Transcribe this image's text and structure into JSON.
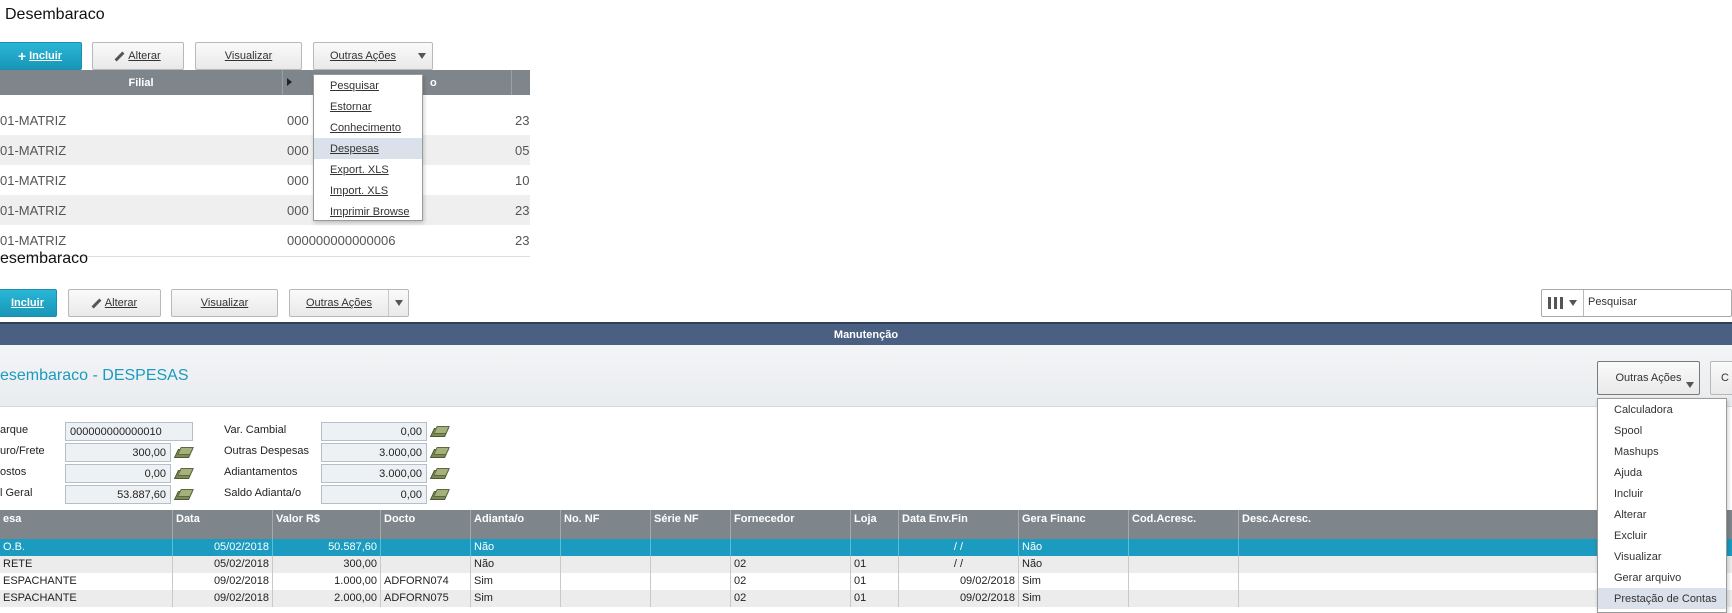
{
  "top": {
    "title": "Desembaraco",
    "toolbar": {
      "incluir_label": "Incluir",
      "alterar_label": "Alterar",
      "visualizar_label": "Visualizar",
      "outras_acoes_label": "Outras Ações"
    },
    "grid": {
      "columns": [
        "Filial",
        "o"
      ],
      "rows": [
        {
          "filial": "01-MATRIZ",
          "codigo": "000",
          "col3": "23"
        },
        {
          "filial": "01-MATRIZ",
          "codigo": "000",
          "col3": "05"
        },
        {
          "filial": "01-MATRIZ",
          "codigo": "000",
          "col3": "10"
        },
        {
          "filial": "01-MATRIZ",
          "codigo": "000",
          "col3": "23"
        },
        {
          "filial": "01-MATRIZ",
          "codigo": "000000000000006",
          "col3": "23"
        }
      ]
    },
    "dropdown": {
      "items": [
        {
          "label": "Pesquisar"
        },
        {
          "label": "Estornar"
        },
        {
          "label": "Conhecimento"
        },
        {
          "label": "Despesas",
          "highlighted": true
        },
        {
          "label": "Export. XLS"
        },
        {
          "label": "Import. XLS"
        },
        {
          "label": "Imprimir Browse"
        }
      ]
    }
  },
  "second": {
    "title": "esembaraco",
    "toolbar": {
      "incluir_label": "Incluir",
      "alterar_label": "Alterar",
      "visualizar_label": "Visualizar",
      "outras_acoes_label": "Outras Ações",
      "search_placeholder": "Pesquisar"
    }
  },
  "manutencao": {
    "bar_title": "Manutenção",
    "form_title": "esembaraco - DESPESAS",
    "outras_acoes_label": "Outras Ações",
    "c_button_label": "C",
    "fields_left": [
      {
        "label": "arque",
        "value": "000000000000010"
      },
      {
        "label": "uro/Frete",
        "value": "300,00"
      },
      {
        "label": "ostos",
        "value": "0,00"
      },
      {
        "label": "l Geral",
        "value": "53.887,60"
      }
    ],
    "fields_right": [
      {
        "label": "Var. Cambial",
        "value": "0,00"
      },
      {
        "label": "Outras Despesas",
        "value": "3.000,00"
      },
      {
        "label": "Adiantamentos",
        "value": "3.000,00"
      },
      {
        "label": "Saldo Adianta/o",
        "value": "0,00"
      }
    ],
    "grid": {
      "columns": [
        "esa",
        "Data",
        "Valor R$",
        "Docto",
        "Adianta/o",
        "No. NF",
        "Série NF",
        "Fornecedor",
        "Loja",
        "Data Env.Fin",
        "Gera Financ",
        "Cod.Acresc.",
        "Desc.Acresc."
      ],
      "rows": [
        [
          "O.B.",
          "05/02/2018",
          "50.587,60",
          "",
          "Não",
          "",
          "",
          "",
          "",
          "/  /",
          "Não",
          "",
          ""
        ],
        [
          "RETE",
          "05/02/2018",
          "300,00",
          "",
          "Não",
          "",
          "",
          "02",
          "01",
          "/  /",
          "Não",
          "",
          ""
        ],
        [
          "ESPACHANTE",
          "09/02/2018",
          "1.000,00",
          "ADFORN074",
          "Sim",
          "",
          "",
          "02",
          "01",
          "09/02/2018",
          "Sim",
          "",
          ""
        ],
        [
          "ESPACHANTE",
          "09/02/2018",
          "2.000,00",
          "ADFORN075",
          "Sim",
          "",
          "",
          "02",
          "01",
          "09/02/2018",
          "Sim",
          "",
          ""
        ]
      ]
    },
    "dropdown": {
      "items": [
        {
          "label": "Calculadora"
        },
        {
          "label": "Spool"
        },
        {
          "label": "Mashups"
        },
        {
          "label": "Ajuda"
        },
        {
          "label": "Incluir"
        },
        {
          "label": "Alterar"
        },
        {
          "label": "Excluir"
        },
        {
          "label": "Visualizar"
        },
        {
          "label": "Gerar arquivo"
        },
        {
          "label": "Prestação de Contas",
          "highlighted": true
        }
      ]
    }
  }
}
